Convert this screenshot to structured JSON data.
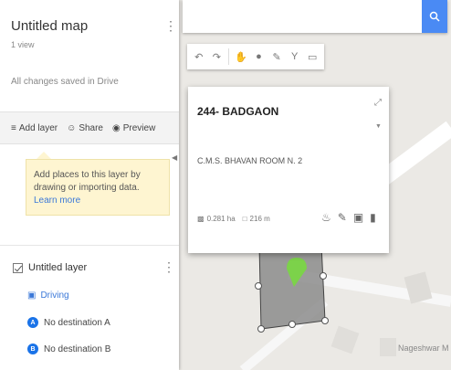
{
  "map_title": "Untitled map",
  "views": "1 view",
  "saved_status": "All changes saved in Drive",
  "actions": {
    "add_layer": "Add layer",
    "share": "Share",
    "preview": "Preview"
  },
  "hint": {
    "text": "Add places to this layer by drawing or importing data.",
    "link": "Learn more"
  },
  "layer": {
    "name": "Untitled layer",
    "mode": "Driving",
    "destinations": [
      {
        "letter": "A",
        "label": "No destination A"
      },
      {
        "letter": "B",
        "label": "No destination B"
      }
    ]
  },
  "card": {
    "title": "244- BADGAON",
    "description": "C.M.S. BHAVAN ROOM N. 2",
    "area": "0.281 ha",
    "perimeter": "216 m"
  },
  "map_label": "Nageshwar M",
  "colors": {
    "accent": "#4a8af4",
    "link": "#3b78d8",
    "polygon_fill": "#8c8c8c",
    "pin": "#7cd24a",
    "hint_bg": "#fef5d1"
  }
}
